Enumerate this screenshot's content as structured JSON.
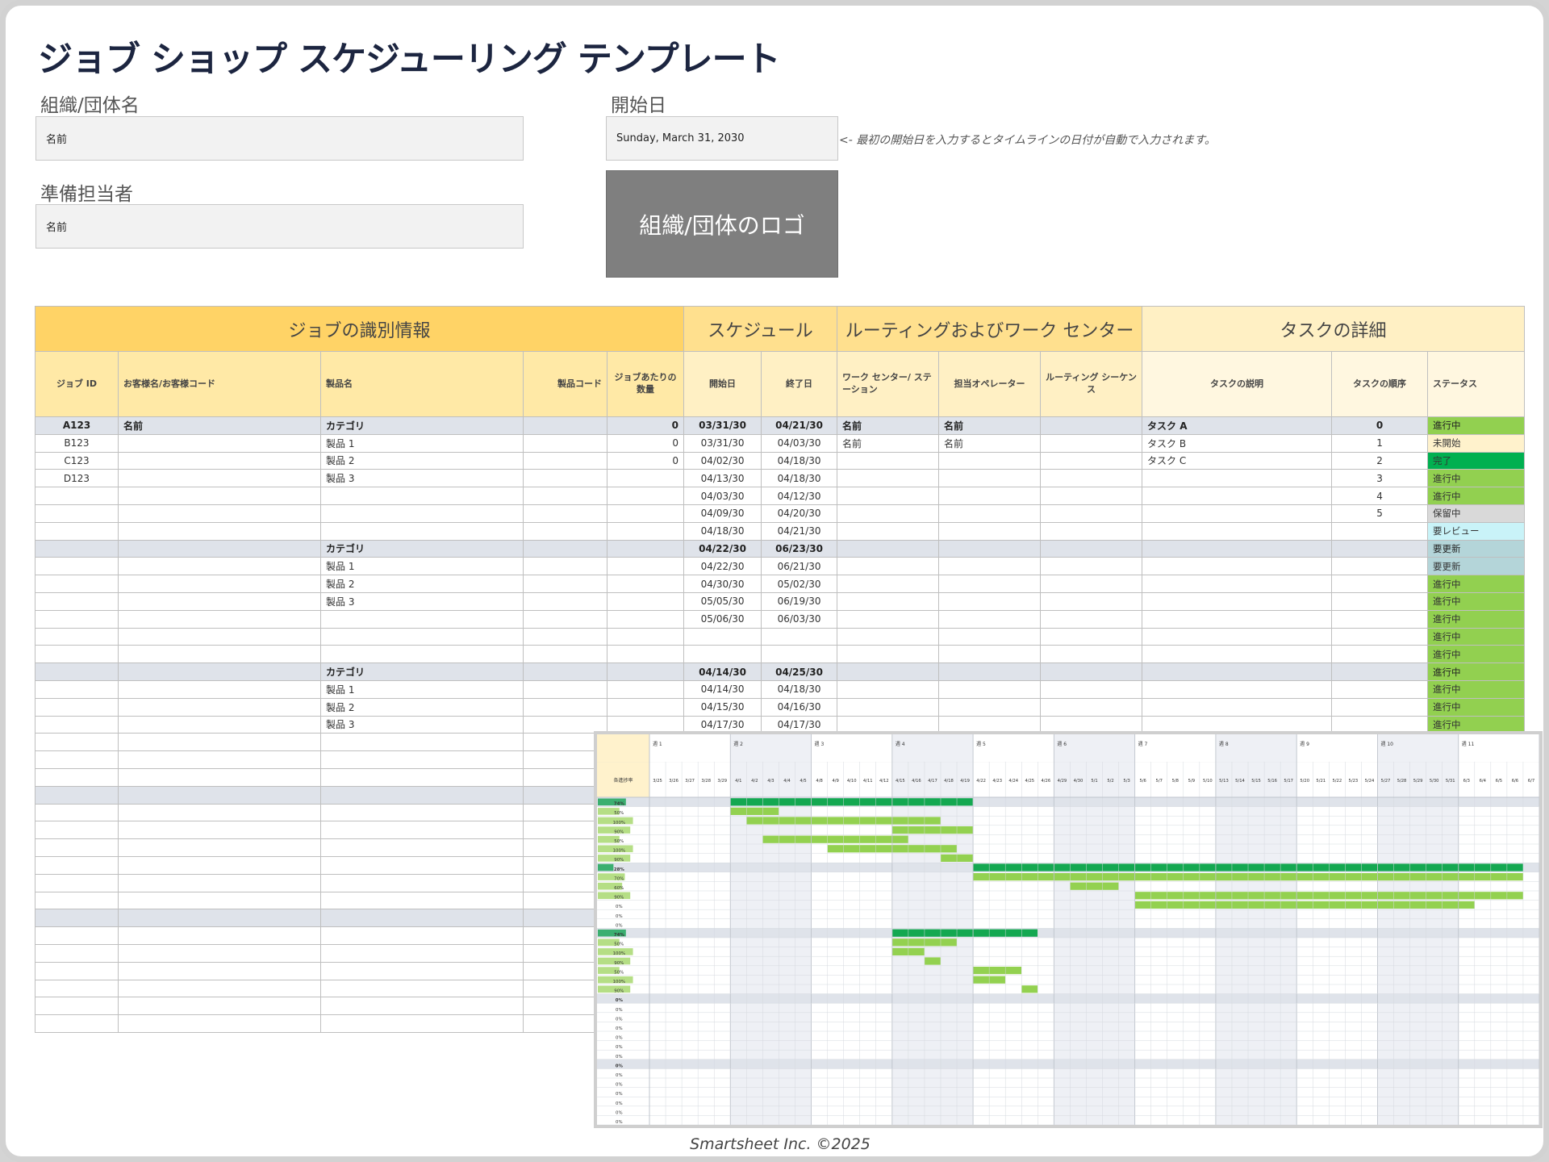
{
  "title": "ジョブ ショップ スケジューリング テンプレート",
  "org_label": "組織/団体名",
  "org_value": "名前",
  "preparer_label": "準備担当者",
  "preparer_value": "名前",
  "start_label": "開始日",
  "start_value": "Sunday, March 31, 2030",
  "hint": "<- 最初の開始日を入力するとタイムラインの日付が自動で入力されます。",
  "logo_text": "組織/団体のロゴ",
  "sections": [
    "ジョブの識別情報",
    "スケジュール",
    "ルーティングおよびワーク センター",
    "タスクの詳細"
  ],
  "columns": [
    "ジョブ ID",
    "お客様名/お客様コード",
    "製品名",
    "製品コード",
    "ジョブあたりの数量",
    "開始日",
    "終了日",
    "ワーク センター/ ステーション",
    "担当オペレーター",
    "ルーティング シーケンス",
    "タスクの説明",
    "タスクの順序",
    "ステータス"
  ],
  "rows": [
    {
      "cat": true,
      "c": [
        "A123",
        "名前",
        "カテゴリ",
        "",
        "0",
        "03/31/30",
        "04/21/30",
        "名前",
        "名前",
        "",
        "タスク A",
        "0",
        "進行中"
      ]
    },
    {
      "cat": false,
      "c": [
        "B123",
        "",
        "製品 1",
        "",
        "0",
        "03/31/30",
        "04/03/30",
        "名前",
        "名前",
        "",
        "タスク B",
        "1",
        "未開始"
      ]
    },
    {
      "cat": false,
      "c": [
        "C123",
        "",
        "製品 2",
        "",
        "0",
        "04/02/30",
        "04/18/30",
        "",
        "",
        "",
        "タスク C",
        "2",
        "完了"
      ]
    },
    {
      "cat": false,
      "c": [
        "D123",
        "",
        "製品 3",
        "",
        "",
        "04/13/30",
        "04/18/30",
        "",
        "",
        "",
        "",
        "3",
        "進行中"
      ]
    },
    {
      "cat": false,
      "c": [
        "",
        "",
        "",
        "",
        "",
        "04/03/30",
        "04/12/30",
        "",
        "",
        "",
        "",
        "4",
        "進行中"
      ]
    },
    {
      "cat": false,
      "c": [
        "",
        "",
        "",
        "",
        "",
        "04/09/30",
        "04/20/30",
        "",
        "",
        "",
        "",
        "5",
        "保留中"
      ]
    },
    {
      "cat": false,
      "c": [
        "",
        "",
        "",
        "",
        "",
        "04/18/30",
        "04/21/30",
        "",
        "",
        "",
        "",
        "",
        "要レビュー"
      ]
    },
    {
      "cat": true,
      "c": [
        "",
        "",
        "カテゴリ",
        "",
        "",
        "04/22/30",
        "06/23/30",
        "",
        "",
        "",
        "",
        "",
        "要更新"
      ]
    },
    {
      "cat": false,
      "c": [
        "",
        "",
        "製品 1",
        "",
        "",
        "04/22/30",
        "06/21/30",
        "",
        "",
        "",
        "",
        "",
        "要更新"
      ]
    },
    {
      "cat": false,
      "c": [
        "",
        "",
        "製品 2",
        "",
        "",
        "04/30/30",
        "05/02/30",
        "",
        "",
        "",
        "",
        "",
        "進行中"
      ]
    },
    {
      "cat": false,
      "c": [
        "",
        "",
        "製品 3",
        "",
        "",
        "05/05/30",
        "06/19/30",
        "",
        "",
        "",
        "",
        "",
        "進行中"
      ]
    },
    {
      "cat": false,
      "c": [
        "",
        "",
        "",
        "",
        "",
        "05/06/30",
        "06/03/30",
        "",
        "",
        "",
        "",
        "",
        "進行中"
      ]
    },
    {
      "cat": false,
      "c": [
        "",
        "",
        "",
        "",
        "",
        "",
        "",
        "",
        "",
        "",
        "",
        "",
        "進行中"
      ]
    },
    {
      "cat": false,
      "c": [
        "",
        "",
        "",
        "",
        "",
        "",
        "",
        "",
        "",
        "",
        "",
        "",
        "進行中"
      ]
    },
    {
      "cat": true,
      "c": [
        "",
        "",
        "カテゴリ",
        "",
        "",
        "04/14/30",
        "04/25/30",
        "",
        "",
        "",
        "",
        "",
        "進行中"
      ]
    },
    {
      "cat": false,
      "c": [
        "",
        "",
        "製品 1",
        "",
        "",
        "04/14/30",
        "04/18/30",
        "",
        "",
        "",
        "",
        "",
        "進行中"
      ]
    },
    {
      "cat": false,
      "c": [
        "",
        "",
        "製品 2",
        "",
        "",
        "04/15/30",
        "04/16/30",
        "",
        "",
        "",
        "",
        "",
        "進行中"
      ]
    },
    {
      "cat": false,
      "c": [
        "",
        "",
        "製品 3",
        "",
        "",
        "04/17/30",
        "04/17/30",
        "",
        "",
        "",
        "",
        "",
        "進行中"
      ]
    },
    {
      "cat": false,
      "c": [
        "",
        "",
        "",
        "",
        "",
        "",
        "",
        "",
        "",
        "",
        "",
        "",
        ""
      ]
    },
    {
      "cat": false,
      "c": [
        "",
        "",
        "",
        "",
        "",
        "",
        "",
        "",
        "",
        "",
        "",
        "",
        ""
      ]
    },
    {
      "cat": false,
      "c": [
        "",
        "",
        "",
        "",
        "",
        "",
        "",
        "",
        "",
        "",
        "",
        "",
        ""
      ]
    },
    {
      "cat": true,
      "c": [
        "",
        "",
        "",
        "",
        "",
        "",
        "",
        "",
        "",
        "",
        "",
        "",
        ""
      ]
    },
    {
      "cat": false,
      "c": [
        "",
        "",
        "",
        "",
        "",
        "",
        "",
        "",
        "",
        "",
        "",
        "",
        ""
      ]
    },
    {
      "cat": false,
      "c": [
        "",
        "",
        "",
        "",
        "",
        "",
        "",
        "",
        "",
        "",
        "",
        "",
        ""
      ]
    },
    {
      "cat": false,
      "c": [
        "",
        "",
        "",
        "",
        "",
        "",
        "",
        "",
        "",
        "",
        "",
        "",
        ""
      ]
    },
    {
      "cat": false,
      "c": [
        "",
        "",
        "",
        "",
        "",
        "",
        "",
        "",
        "",
        "",
        "",
        "",
        ""
      ]
    },
    {
      "cat": false,
      "c": [
        "",
        "",
        "",
        "",
        "",
        "",
        "",
        "",
        "",
        "",
        "",
        "",
        ""
      ]
    },
    {
      "cat": false,
      "c": [
        "",
        "",
        "",
        "",
        "",
        "",
        "",
        "",
        "",
        "",
        "",
        "",
        ""
      ]
    },
    {
      "cat": true,
      "c": [
        "",
        "",
        "",
        "",
        "",
        "",
        "",
        "",
        "",
        "",
        "",
        "",
        ""
      ]
    },
    {
      "cat": false,
      "c": [
        "",
        "",
        "",
        "",
        "",
        "",
        "",
        "",
        "",
        "",
        "",
        "",
        ""
      ]
    },
    {
      "cat": false,
      "c": [
        "",
        "",
        "",
        "",
        "",
        "",
        "",
        "",
        "",
        "",
        "",
        "",
        ""
      ]
    },
    {
      "cat": false,
      "c": [
        "",
        "",
        "",
        "",
        "",
        "",
        "",
        "",
        "",
        "",
        "",
        "",
        ""
      ]
    },
    {
      "cat": false,
      "c": [
        "",
        "",
        "",
        "",
        "",
        "",
        "",
        "",
        "",
        "",
        "",
        "",
        ""
      ]
    },
    {
      "cat": false,
      "c": [
        "",
        "",
        "",
        "",
        "",
        "",
        "",
        "",
        "",
        "",
        "",
        "",
        ""
      ]
    },
    {
      "cat": false,
      "c": [
        "",
        "",
        "",
        "",
        "",
        "",
        "",
        "",
        "",
        "",
        "",
        "",
        ""
      ]
    }
  ],
  "status_colors": {
    "進行中": "#92d050",
    "未開始": "#fff2cc",
    "完了": "#00b050",
    "保留中": "#d9d9d9",
    "要レビュー": "#c9f3f8",
    "要更新": "#b4d5d9"
  },
  "colors": {
    "bar_category": "#14a851",
    "bar_task": "#93d150",
    "band": "#dfe3ea",
    "weekend": "#eef0f5"
  },
  "gantt": {
    "progress_header": "各進捗率",
    "weeks": [
      "週 1",
      "週 2",
      "週 3",
      "週 4",
      "週 5",
      "週 6",
      "週 7",
      "週 8",
      "週 9",
      "週 10",
      "週 11"
    ],
    "days": [
      "3/25",
      "3/26",
      "3/27",
      "3/28",
      "3/29",
      "4/1",
      "4/2",
      "4/3",
      "4/4",
      "4/5",
      "4/8",
      "4/9",
      "4/10",
      "4/11",
      "4/12",
      "4/15",
      "4/16",
      "4/17",
      "4/18",
      "4/19",
      "4/22",
      "4/23",
      "4/24",
      "4/25",
      "4/26",
      "4/29",
      "4/30",
      "5/1",
      "5/2",
      "5/3",
      "5/6",
      "5/7",
      "5/8",
      "5/9",
      "5/10",
      "5/13",
      "5/14",
      "5/15",
      "5/16",
      "5/17",
      "5/20",
      "5/21",
      "5/22",
      "5/23",
      "5/24",
      "5/27",
      "5/28",
      "5/29",
      "5/30",
      "5/31",
      "6/3",
      "6/4",
      "6/5",
      "6/6",
      "6/7"
    ],
    "rows": [
      {
        "cat": true,
        "pct": "74%",
        "p": 0.74,
        "bar": [
          5,
          19
        ]
      },
      {
        "cat": false,
        "pct": "50%",
        "p": 0.5,
        "bar": [
          5,
          7
        ]
      },
      {
        "cat": false,
        "pct": "100%",
        "p": 1.0,
        "bar": [
          6,
          17
        ]
      },
      {
        "cat": false,
        "pct": "90%",
        "p": 0.9,
        "bar": [
          15,
          19
        ]
      },
      {
        "cat": false,
        "pct": "50%",
        "p": 0.5,
        "bar": [
          7,
          15
        ]
      },
      {
        "cat": false,
        "pct": "100%",
        "p": 1.0,
        "bar": [
          11,
          18
        ]
      },
      {
        "cat": false,
        "pct": "90%",
        "p": 0.9,
        "bar": [
          18,
          19
        ]
      },
      {
        "cat": true,
        "pct": "28%",
        "p": 0.28,
        "bar": [
          20,
          53
        ]
      },
      {
        "cat": false,
        "pct": "70%",
        "p": 0.7,
        "bar": [
          20,
          53
        ]
      },
      {
        "cat": false,
        "pct": "60%",
        "p": 0.6,
        "bar": [
          26,
          28
        ]
      },
      {
        "cat": false,
        "pct": "90%",
        "p": 0.9,
        "bar": [
          30,
          53
        ]
      },
      {
        "cat": false,
        "pct": "0%",
        "p": 0,
        "bar": [
          30,
          50
        ]
      },
      {
        "cat": false,
        "pct": "0%",
        "p": 0,
        "bar": null
      },
      {
        "cat": false,
        "pct": "0%",
        "p": 0,
        "bar": null
      },
      {
        "cat": true,
        "pct": "74%",
        "p": 0.74,
        "bar": [
          15,
          23
        ]
      },
      {
        "cat": false,
        "pct": "50%",
        "p": 0.5,
        "bar": [
          15,
          18
        ]
      },
      {
        "cat": false,
        "pct": "100%",
        "p": 1.0,
        "bar": [
          15,
          16
        ]
      },
      {
        "cat": false,
        "pct": "90%",
        "p": 0.9,
        "bar": [
          17,
          17
        ]
      },
      {
        "cat": false,
        "pct": "50%",
        "p": 0.5,
        "bar": [
          20,
          22
        ]
      },
      {
        "cat": false,
        "pct": "100%",
        "p": 1.0,
        "bar": [
          20,
          21
        ]
      },
      {
        "cat": false,
        "pct": "90%",
        "p": 0.9,
        "bar": [
          23,
          23
        ]
      },
      {
        "cat": true,
        "pct": "0%",
        "p": 0,
        "bar": null
      },
      {
        "cat": false,
        "pct": "0%",
        "p": 0,
        "bar": null
      },
      {
        "cat": false,
        "pct": "0%",
        "p": 0,
        "bar": null
      },
      {
        "cat": false,
        "pct": "0%",
        "p": 0,
        "bar": null
      },
      {
        "cat": false,
        "pct": "0%",
        "p": 0,
        "bar": null
      },
      {
        "cat": false,
        "pct": "0%",
        "p": 0,
        "bar": null
      },
      {
        "cat": false,
        "pct": "0%",
        "p": 0,
        "bar": null
      },
      {
        "cat": true,
        "pct": "0%",
        "p": 0,
        "bar": null
      },
      {
        "cat": false,
        "pct": "0%",
        "p": 0,
        "bar": null
      },
      {
        "cat": false,
        "pct": "0%",
        "p": 0,
        "bar": null
      },
      {
        "cat": false,
        "pct": "0%",
        "p": 0,
        "bar": null
      },
      {
        "cat": false,
        "pct": "0%",
        "p": 0,
        "bar": null
      },
      {
        "cat": false,
        "pct": "0%",
        "p": 0,
        "bar": null
      },
      {
        "cat": false,
        "pct": "0%",
        "p": 0,
        "bar": null
      }
    ]
  },
  "footer": "Smartsheet Inc. ©2025"
}
